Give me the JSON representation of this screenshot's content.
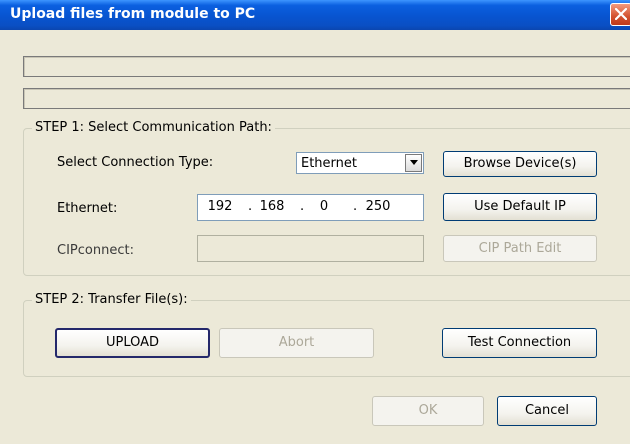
{
  "window": {
    "title": "Upload files from module to PC",
    "close_icon": "close-icon"
  },
  "step1": {
    "legend": "STEP 1: Select Communication Path:",
    "connection_type_label": "Select Connection Type:",
    "connection_type_value": "Ethernet",
    "browse_button": "Browse Device(s)",
    "ethernet_label": "Ethernet:",
    "ip": {
      "octet1": "192",
      "octet2": "168",
      "octet3": "0",
      "octet4": "250",
      "sep": "."
    },
    "default_ip_button": "Use Default IP",
    "cip_label": "CIPconnect:",
    "cip_value": "",
    "cip_path_button": "CIP Path Edit"
  },
  "step2": {
    "legend": "STEP 2: Transfer File(s):",
    "upload_button": "UPLOAD",
    "abort_button": "Abort",
    "test_button": "Test Connection"
  },
  "footer": {
    "ok_button": "OK",
    "cancel_button": "Cancel"
  },
  "colors": {
    "titlebar": "#0a5fe0",
    "dialog_bg": "#ece9d8",
    "button_border": "#003c74",
    "close_button": "#d2512e"
  }
}
